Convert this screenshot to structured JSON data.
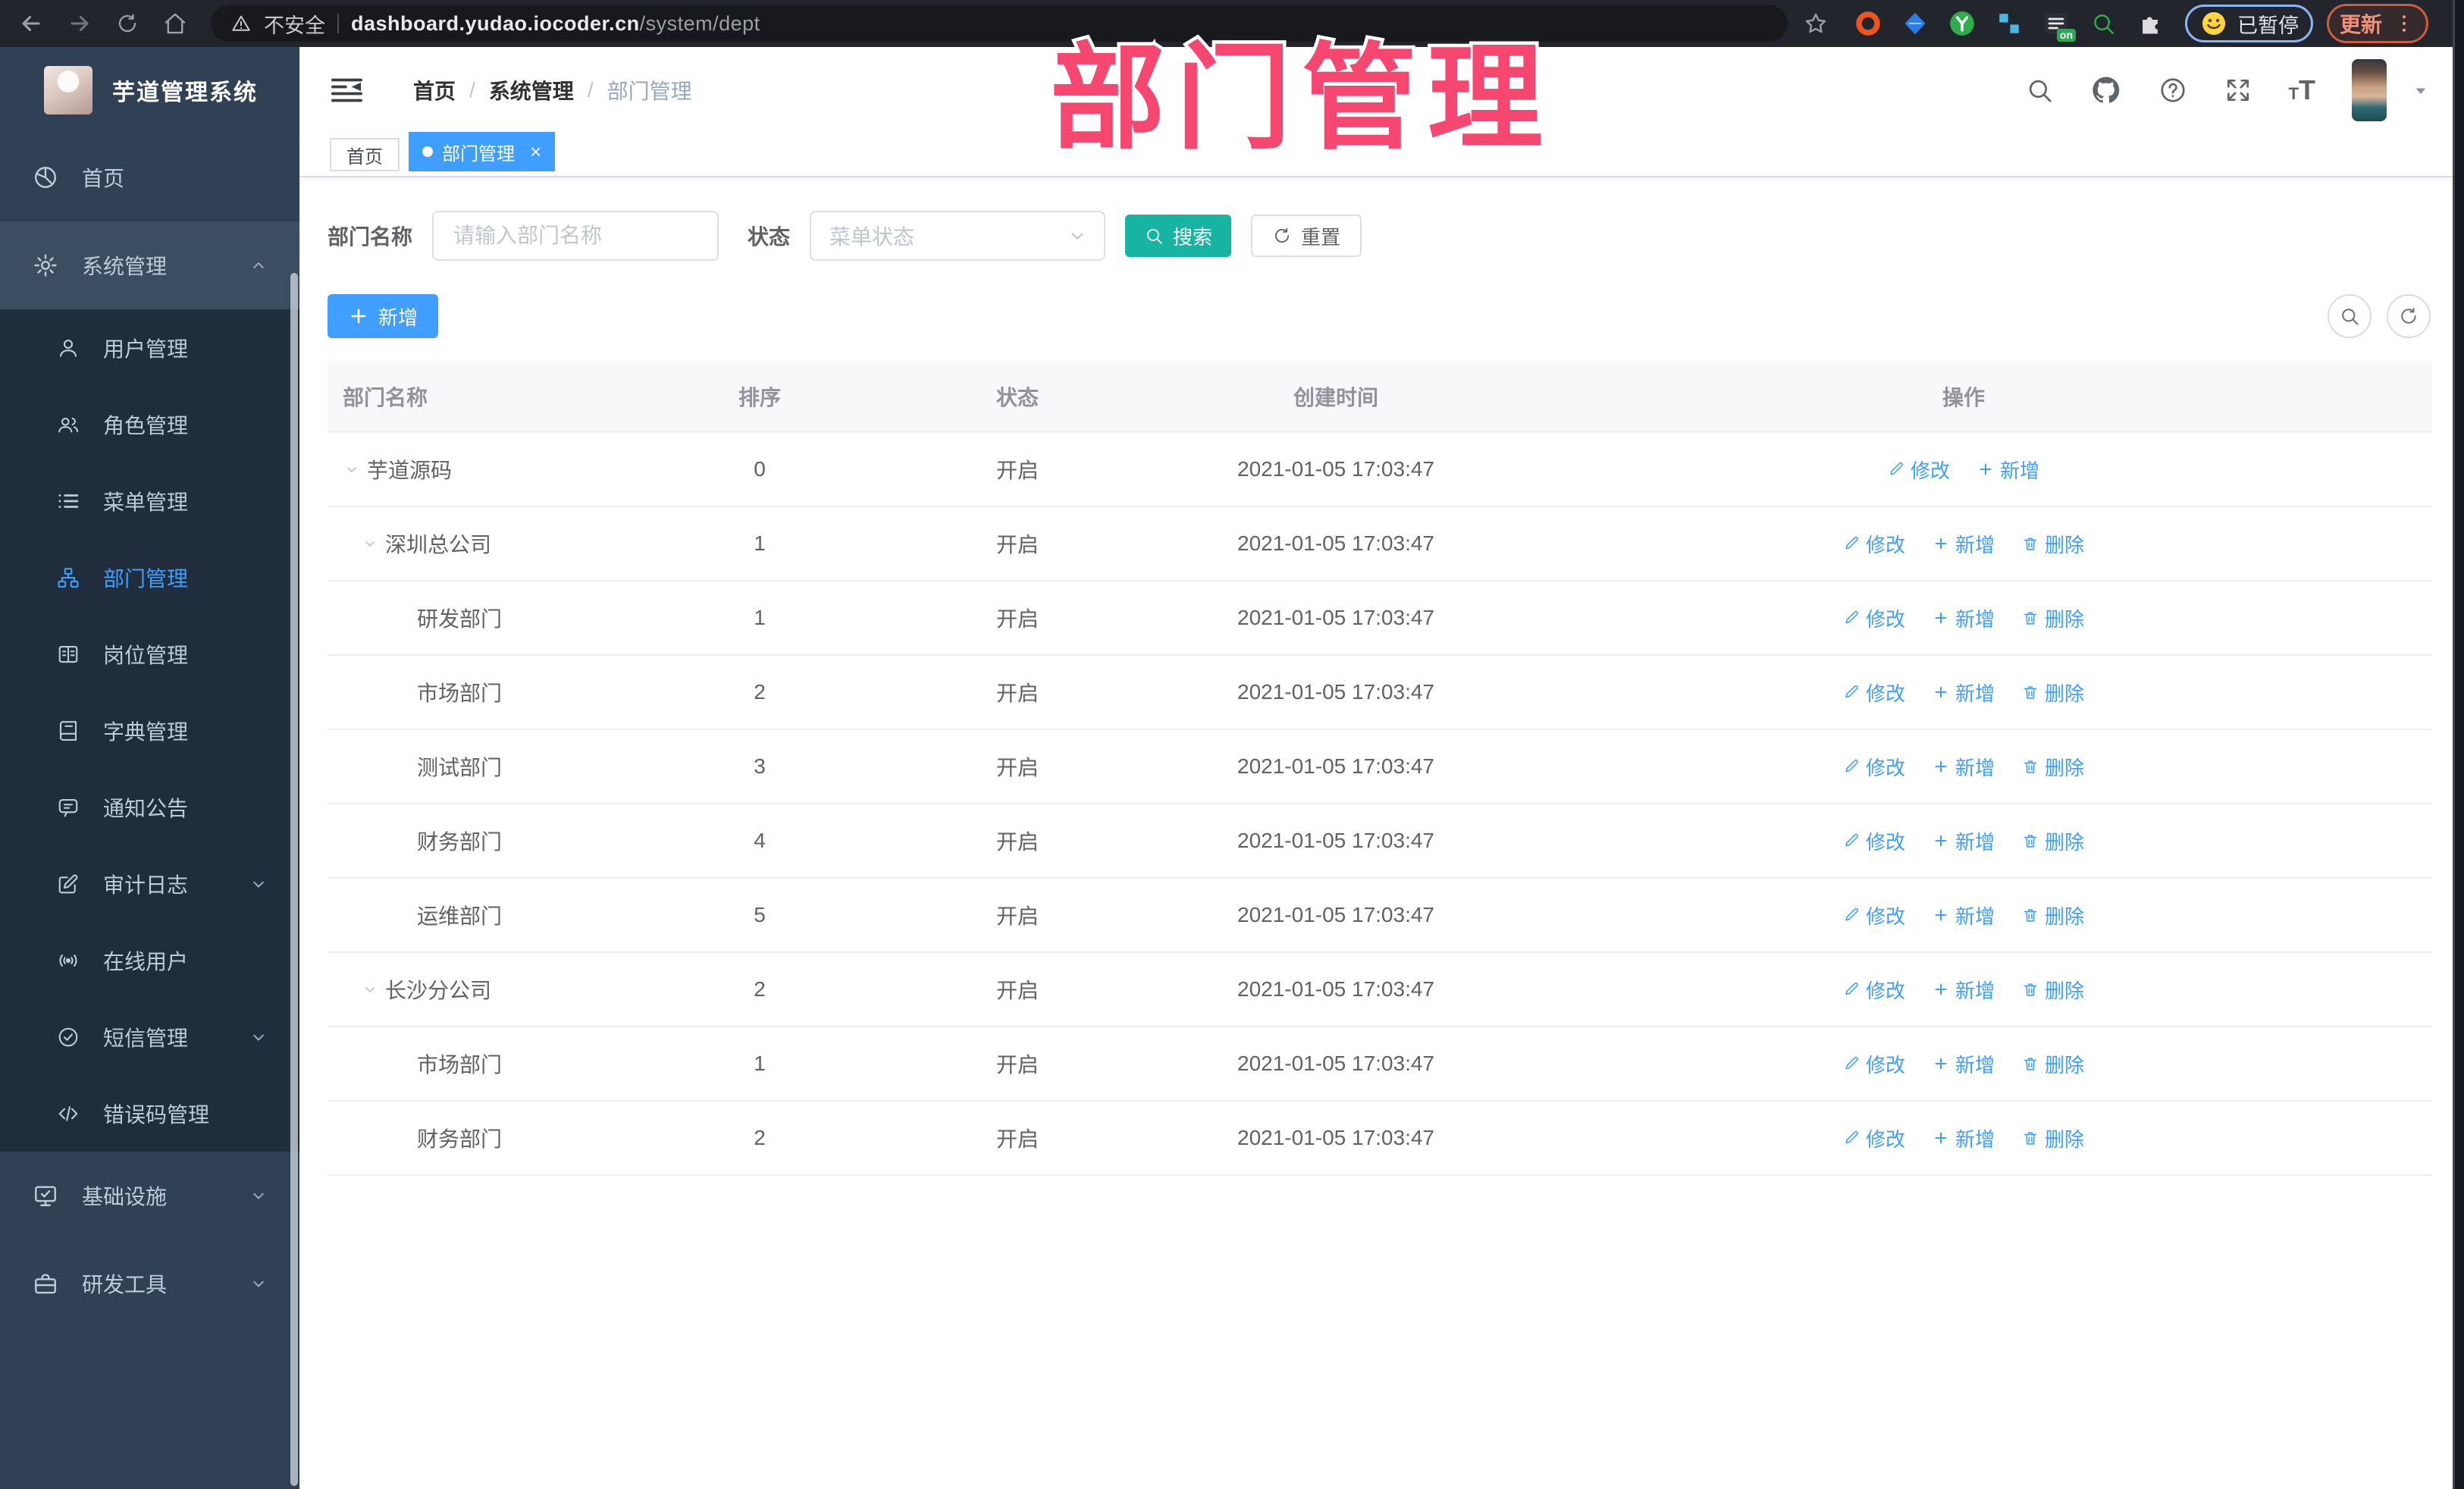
{
  "chrome": {
    "security_label": "不安全",
    "url_host": "dashboard.yudao.iocoder.cn",
    "url_path": "/system/dept",
    "paused_label": "已暂停",
    "update_label": "更新"
  },
  "watermark": {
    "text": "部门管理"
  },
  "sidebar": {
    "app_title": "芋道管理系统",
    "items": [
      {
        "label": "首页",
        "icon": "dashboard-icon",
        "type": "top"
      },
      {
        "label": "系统管理",
        "icon": "gear-icon",
        "type": "top",
        "chevron": "up",
        "open": true
      },
      {
        "label": "用户管理",
        "icon": "user-icon",
        "type": "sub"
      },
      {
        "label": "角色管理",
        "icon": "users-icon",
        "type": "sub"
      },
      {
        "label": "菜单管理",
        "icon": "menulist-icon",
        "type": "sub"
      },
      {
        "label": "部门管理",
        "icon": "tree-icon",
        "type": "sub",
        "active": true
      },
      {
        "label": "岗位管理",
        "icon": "idcard-icon",
        "type": "sub"
      },
      {
        "label": "字典管理",
        "icon": "dict-icon",
        "type": "sub"
      },
      {
        "label": "通知公告",
        "icon": "notice-icon",
        "type": "sub"
      },
      {
        "label": "审计日志",
        "icon": "log-icon",
        "type": "sub",
        "chevron": "down"
      },
      {
        "label": "在线用户",
        "icon": "online-icon",
        "type": "sub"
      },
      {
        "label": "短信管理",
        "icon": "sms-icon",
        "type": "sub",
        "chevron": "down"
      },
      {
        "label": "错误码管理",
        "icon": "code-icon",
        "type": "sub"
      },
      {
        "label": "基础设施",
        "icon": "infra-icon",
        "type": "top",
        "chevron": "down"
      },
      {
        "label": "研发工具",
        "icon": "tools-icon",
        "type": "top",
        "chevron": "down"
      }
    ]
  },
  "header": {
    "breadcrumb": [
      "首页",
      "系统管理",
      "部门管理"
    ]
  },
  "tabs": [
    {
      "label": "首页",
      "active": false
    },
    {
      "label": "部门管理",
      "active": true,
      "closable": true
    }
  ],
  "filters": {
    "name_label": "部门名称",
    "name_placeholder": "请输入部门名称",
    "status_label": "状态",
    "status_placeholder": "菜单状态",
    "search_label": "搜索",
    "reset_label": "重置"
  },
  "toolbar": {
    "add_label": "新增"
  },
  "table": {
    "columns": [
      "部门名称",
      "排序",
      "状态",
      "创建时间",
      "操作"
    ],
    "action_labels": {
      "edit": "修改",
      "add": "新增",
      "delete": "删除"
    },
    "rows": [
      {
        "name": "芋道源码",
        "level": 0,
        "expandable": true,
        "sort": "0",
        "status": "开启",
        "created": "2021-01-05 17:03:47",
        "actions": [
          "edit",
          "add"
        ]
      },
      {
        "name": "深圳总公司",
        "level": 1,
        "expandable": true,
        "sort": "1",
        "status": "开启",
        "created": "2021-01-05 17:03:47",
        "actions": [
          "edit",
          "add",
          "delete"
        ]
      },
      {
        "name": "研发部门",
        "level": 2,
        "expandable": false,
        "sort": "1",
        "status": "开启",
        "created": "2021-01-05 17:03:47",
        "actions": [
          "edit",
          "add",
          "delete"
        ]
      },
      {
        "name": "市场部门",
        "level": 2,
        "expandable": false,
        "sort": "2",
        "status": "开启",
        "created": "2021-01-05 17:03:47",
        "actions": [
          "edit",
          "add",
          "delete"
        ]
      },
      {
        "name": "测试部门",
        "level": 2,
        "expandable": false,
        "sort": "3",
        "status": "开启",
        "created": "2021-01-05 17:03:47",
        "actions": [
          "edit",
          "add",
          "delete"
        ]
      },
      {
        "name": "财务部门",
        "level": 2,
        "expandable": false,
        "sort": "4",
        "status": "开启",
        "created": "2021-01-05 17:03:47",
        "actions": [
          "edit",
          "add",
          "delete"
        ]
      },
      {
        "name": "运维部门",
        "level": 2,
        "expandable": false,
        "sort": "5",
        "status": "开启",
        "created": "2021-01-05 17:03:47",
        "actions": [
          "edit",
          "add",
          "delete"
        ]
      },
      {
        "name": "长沙分公司",
        "level": 1,
        "expandable": true,
        "sort": "2",
        "status": "开启",
        "created": "2021-01-05 17:03:47",
        "actions": [
          "edit",
          "add",
          "delete"
        ]
      },
      {
        "name": "市场部门",
        "level": 2,
        "expandable": false,
        "sort": "1",
        "status": "开启",
        "created": "2021-01-05 17:03:47",
        "actions": [
          "edit",
          "add",
          "delete"
        ]
      },
      {
        "name": "财务部门",
        "level": 2,
        "expandable": false,
        "sort": "2",
        "status": "开启",
        "created": "2021-01-05 17:03:47",
        "actions": [
          "edit",
          "add",
          "delete"
        ]
      }
    ]
  },
  "colors": {
    "accent": "#409eff",
    "search_button": "#17b3a3",
    "sidebar_bg": "#304156",
    "submenu_bg": "#1f2d3d",
    "active_text": "#409eff",
    "watermark": "#f5476f",
    "table_header_bg": "#f7f8fa",
    "row_divider": "#ebeef5"
  }
}
